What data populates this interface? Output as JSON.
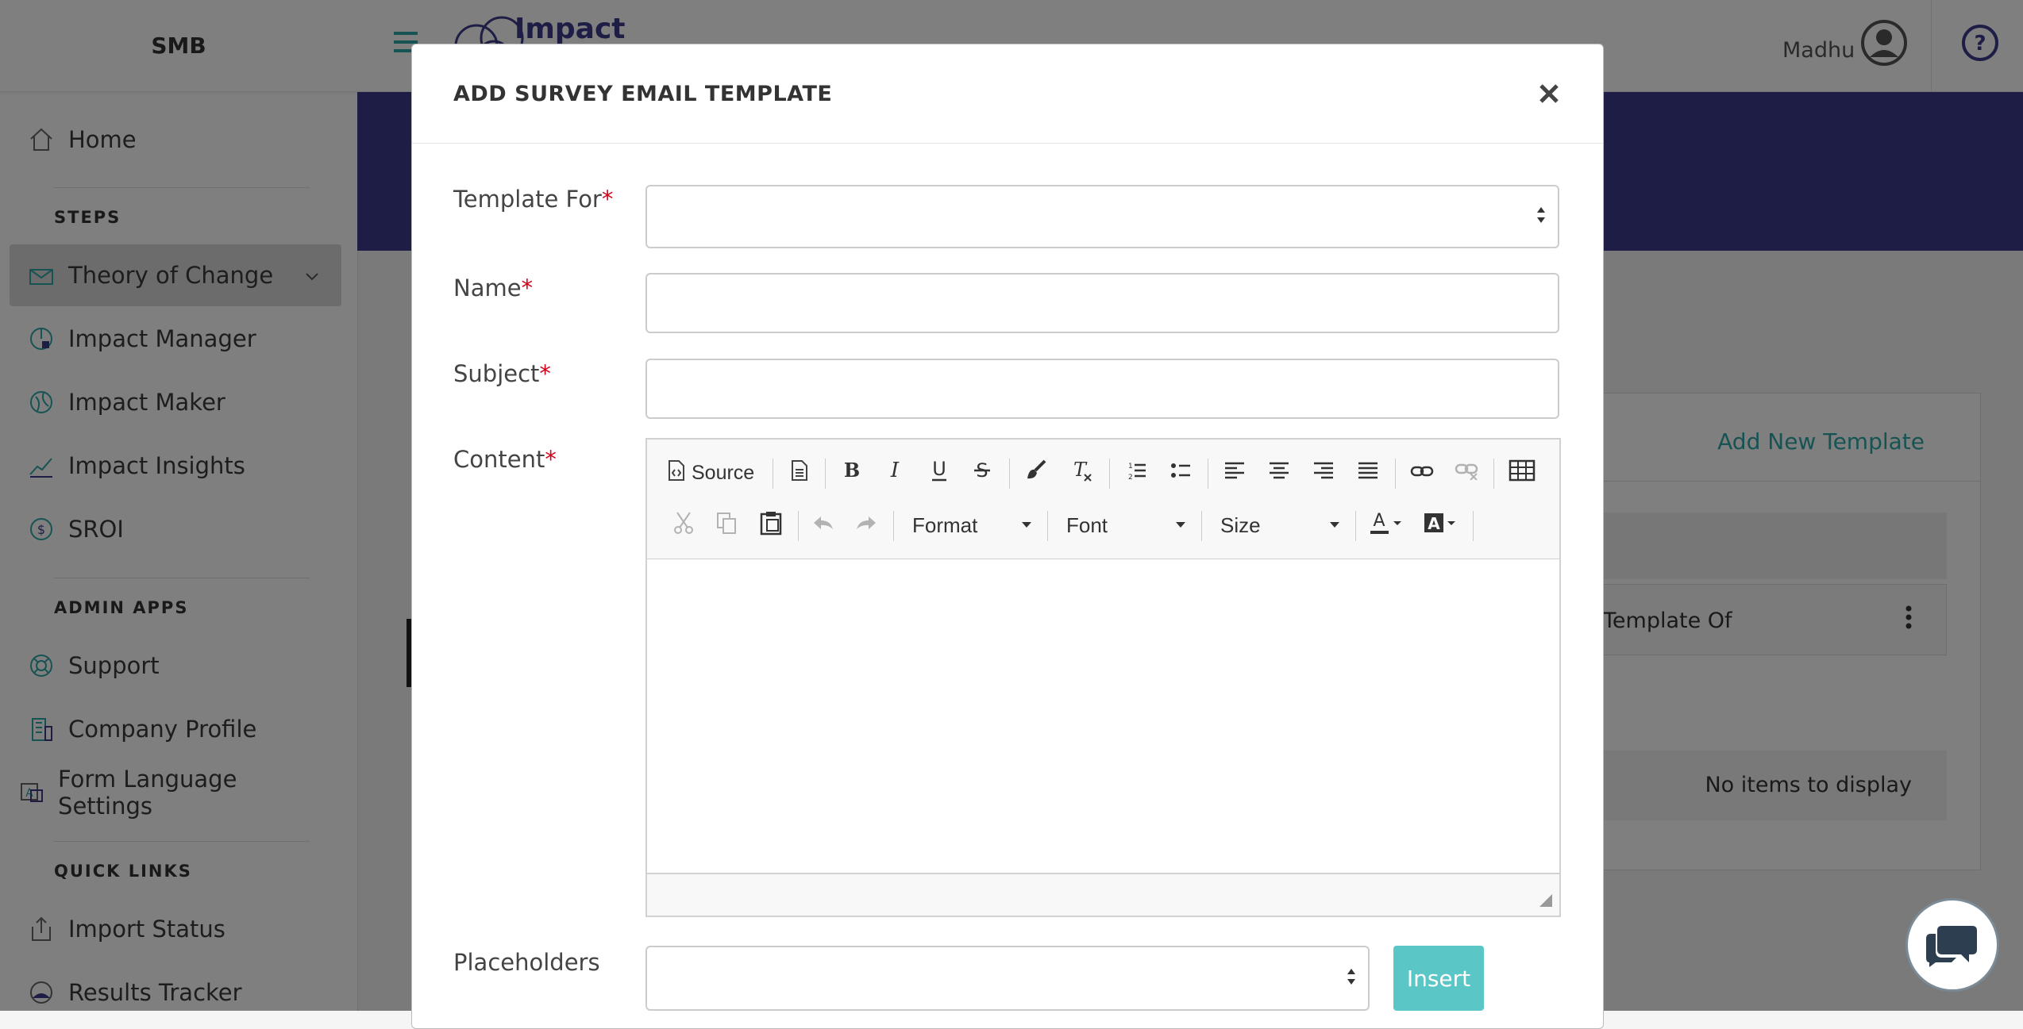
{
  "sidebar": {
    "brand": "SMB",
    "home": "Home",
    "steps_header": "STEPS",
    "steps": [
      "Theory of Change",
      "Impact Manager",
      "Impact Maker",
      "Impact Insights",
      "SROI"
    ],
    "admin_header": "ADMIN APPS",
    "admin": [
      "Support",
      "Company Profile",
      "Form Language Settings"
    ],
    "quick_header": "QUICK LINKS",
    "quick": [
      "Import Status",
      "Results Tracker"
    ]
  },
  "header": {
    "logo_text": "Impact",
    "user_name": "Madhu"
  },
  "background_page": {
    "add_new_template": "Add New Template",
    "column_template_of": "Template Of",
    "empty_text": "No items to display"
  },
  "modal": {
    "title": "ADD SURVEY EMAIL TEMPLATE",
    "template_for_label": "Template For",
    "name_label": "Name",
    "subject_label": "Subject",
    "content_label": "Content",
    "placeholders_label": "Placeholders",
    "required_mark": "*",
    "template_for_value": "",
    "name_value": "",
    "subject_value": "",
    "placeholders_value": "",
    "insert_label": "Insert"
  },
  "editor": {
    "source_label": "Source",
    "format_label": "Format",
    "font_label": "Font",
    "size_label": "Size"
  },
  "colors": {
    "banner": "#3b3a8a",
    "accent_teal": "#2fa6a6",
    "insert_button": "#5bc6c6",
    "required": "#d0021b"
  }
}
